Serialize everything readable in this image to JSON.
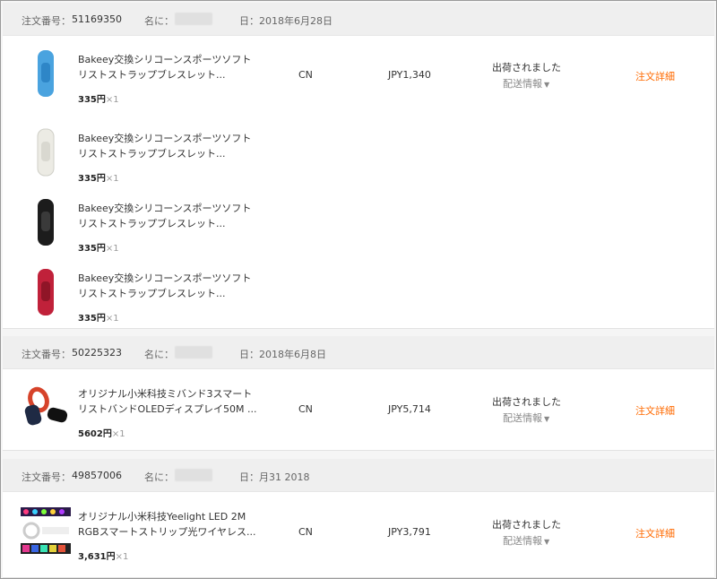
{
  "labels": {
    "order_number": "注文番号：",
    "name": "名に：",
    "date_prefix": "日：",
    "shipped": "出荷されました",
    "shipping_info": "配送情報",
    "order_detail": "注文詳細"
  },
  "orders": [
    {
      "number": "51169350",
      "date": "2018年6月28日",
      "ship_from": "CN",
      "total": "JPY1,340",
      "items": [
        {
          "title_line1": "Bakeey交換シリコーンスポーツソフト",
          "title_line2": "リストストラップブレスレット...",
          "price": "335円",
          "qty": "×1",
          "color": "#4aa3df"
        },
        {
          "title_line1": "Bakeey交換シリコーンスポーツソフト",
          "title_line2": "リストストラップブレスレット...",
          "price": "335円",
          "qty": "×1",
          "color": "#ecebe4"
        },
        {
          "title_line1": "Bakeey交換シリコーンスポーツソフト",
          "title_line2": "リストストラップブレスレット...",
          "price": "335円",
          "qty": "×1",
          "color": "#1c1c1c"
        },
        {
          "title_line1": "Bakeey交換シリコーンスポーツソフト",
          "title_line2": "リストストラップブレスレット...",
          "price": "335円",
          "qty": "×1",
          "color": "#c0213a"
        }
      ]
    },
    {
      "number": "50225323",
      "date": "2018年6月8日",
      "ship_from": "CN",
      "total": "JPY5,714",
      "items": [
        {
          "title_line1": "オリジナル小米科技ミバンド3スマート",
          "title_line2": "リストバンドOLEDディスプレイ50M ...",
          "price": "5602円",
          "qty": "×1"
        }
      ]
    },
    {
      "number": "49857006",
      "date": "月31 2018",
      "ship_from": "CN",
      "total": "JPY3,791",
      "items": [
        {
          "title_line1": "オリジナル小米科技Yeelight LED 2M",
          "title_line2": "RGBスマートストリップ光ワイヤレス...",
          "price": "3,631円",
          "qty": "×1"
        }
      ]
    }
  ]
}
